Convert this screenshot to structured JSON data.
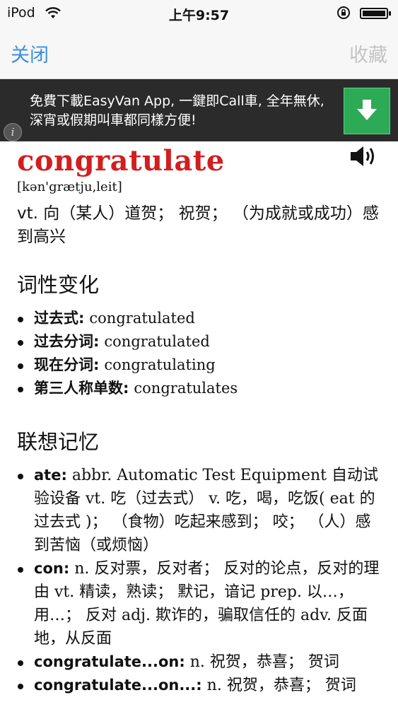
{
  "status_bar": {
    "carrier": "iPod",
    "time": "上午9:57"
  },
  "nav": {
    "close_label": "关闭",
    "favorite_label": "收藏"
  },
  "ad": {
    "text": "免費下載EasyVan App, 一鍵即Call車, 全年無休, 深宵或假期叫車都同樣方便!"
  },
  "entry": {
    "word": "congratulate",
    "phonetic": "[kən'grætju,leit]",
    "definition": "vt. 向（某人）道贺； 祝贺； （为成就或成功）感到高兴"
  },
  "inflections": {
    "heading": "词性变化",
    "items": [
      {
        "key": "过去式:",
        "value": "congratulated"
      },
      {
        "key": "过去分词:",
        "value": "congratulated"
      },
      {
        "key": "现在分词:",
        "value": "congratulating"
      },
      {
        "key": "第三人称单数:",
        "value": "congratulates"
      }
    ]
  },
  "associations": {
    "heading": "联想记忆",
    "items": [
      {
        "key": "ate:",
        "value": "abbr. Automatic Test Equipment 自动试验设备 vt. 吃（过去式） v. 吃，喝，吃饭( eat 的过去式 )； （食物）吃起来感到； 咬； （人）感到苦恼（或烦恼）"
      },
      {
        "key": "con:",
        "value": "n. 反对票，反对者； 反对的论点，反对的理由 vt. 精读，熟读； 默记，谙记 prep. 以…，用…； 反对 adj. 欺诈的，骗取信任的 adv. 反面地，从反面"
      },
      {
        "key": "congratulate...on:",
        "value": "n. 祝贺，恭喜； 贺词"
      },
      {
        "key": "congratulate...on...:",
        "value": "n. 祝贺，恭喜； 贺词"
      }
    ]
  }
}
